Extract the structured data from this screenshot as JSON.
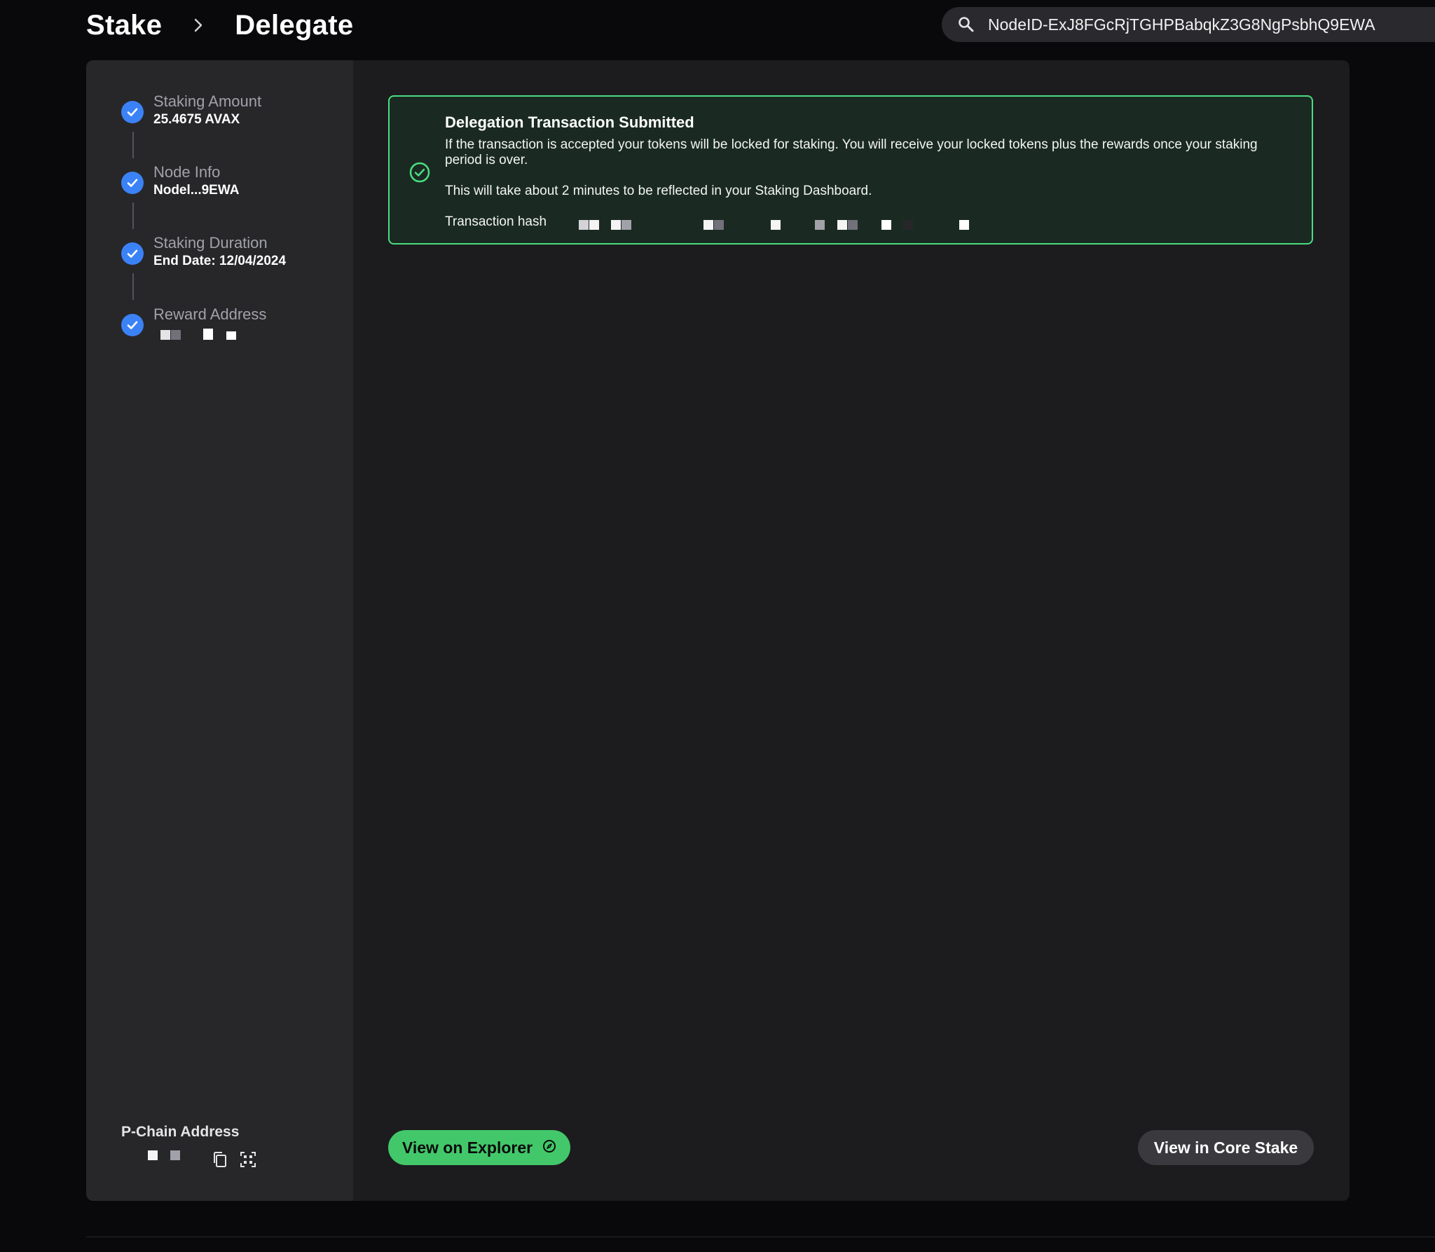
{
  "header": {
    "crumb_root": "Stake",
    "crumb_current": "Delegate",
    "search_value": "NodeID-ExJ8FGcRjTGHPBabqkZ3G8NgPsbhQ9EWA",
    "icons": {
      "separator": "chevron-right-icon",
      "search": "search-icon"
    }
  },
  "sidebar": {
    "steps": [
      {
        "label": "Staking Amount",
        "value": "25.4675 AVAX"
      },
      {
        "label": "Node Info",
        "value": "Nodel...9EWA"
      },
      {
        "label": "Staking Duration",
        "value": "End Date: 12/04/2024"
      },
      {
        "label": "Reward Address",
        "value": ""
      }
    ],
    "pchain_label": "P-Chain Address",
    "icons": {
      "step": "check-circle-icon",
      "copy": "copy-icon",
      "qr": "qr-code-icon"
    }
  },
  "alert": {
    "title": "Delegation Transaction Submitted",
    "body": "If the transaction is accepted your tokens will be locked for staking. You will receive your locked tokens plus the rewards once your staking period is over.",
    "note": "This will take about 2 minutes to be reflected in your Staking Dashboard.",
    "hash_label": "Transaction hash",
    "icon": "check-circle-icon"
  },
  "actions": {
    "explorer_label": "View on Explorer",
    "core_label": "View in Core Stake",
    "explorer_icon": "compass-icon"
  },
  "colors": {
    "accent_green": "#42c86a",
    "step_blue": "#3b82f6",
    "alert_border": "#4ade80",
    "background": "#09090b"
  }
}
